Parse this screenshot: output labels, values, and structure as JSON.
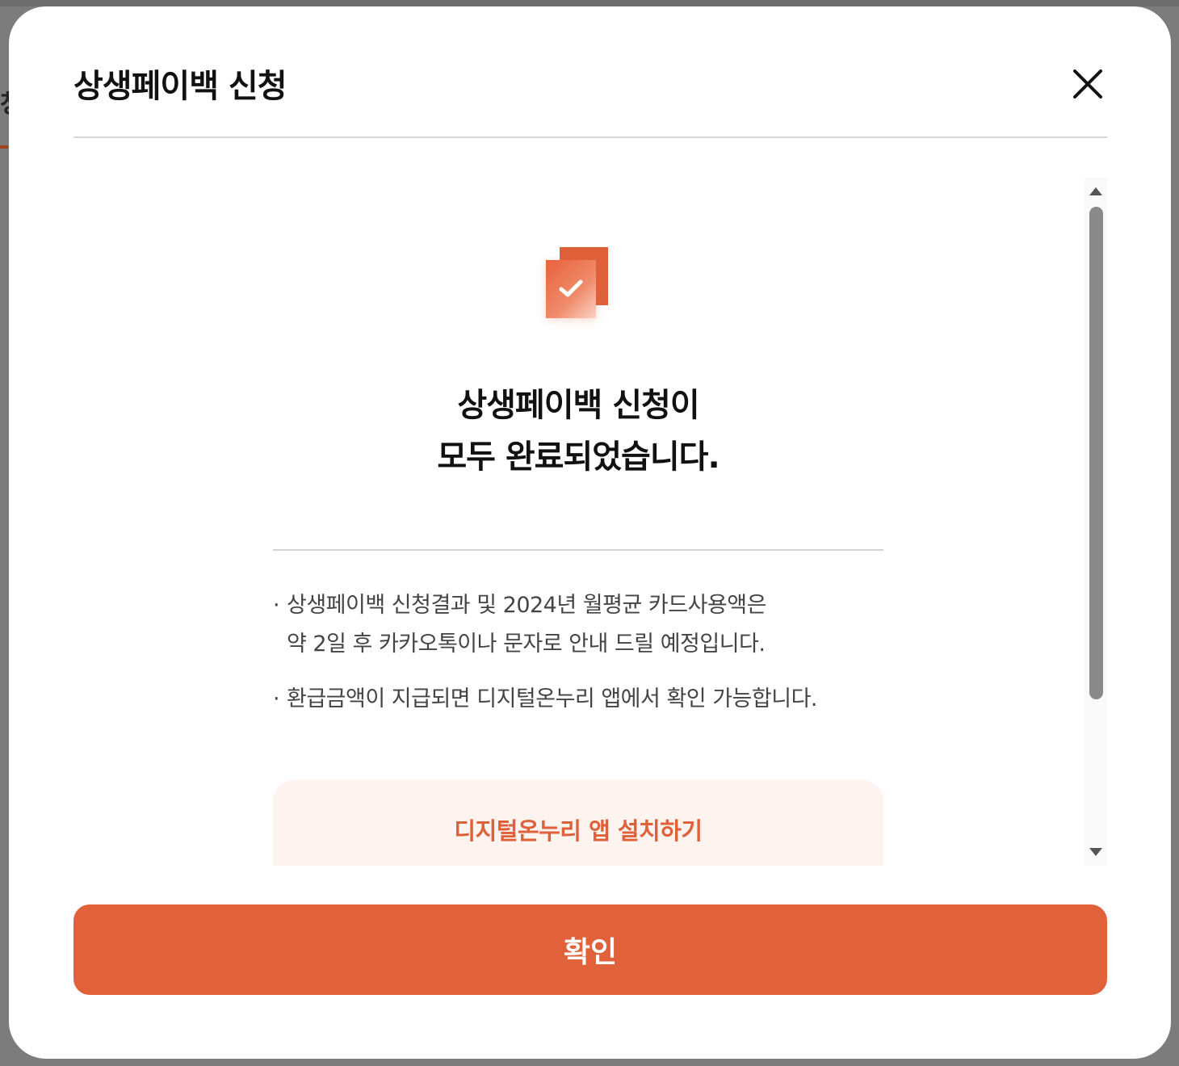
{
  "background": {
    "fragment_text": "청"
  },
  "modal": {
    "title": "상생페이백 신청",
    "close_icon": "close-icon"
  },
  "success": {
    "icon": "check-document-icon",
    "title_line1": "상생페이백 신청이",
    "title_line2": "모두 완료되었습니다."
  },
  "notices": [
    {
      "bullet": "·",
      "lines": [
        "상생페이백 신청결과 및 2024년 월평균 카드사용액은",
        "약 2일 후 카카오톡이나 문자로 안내 드릴 예정입니다."
      ]
    },
    {
      "bullet": "·",
      "lines": [
        "환급금액이 지급되면 디지털온누리 앱에서 확인 가능합니다."
      ]
    }
  ],
  "install": {
    "label": "디지털온누리 앱 설치하기"
  },
  "footer": {
    "confirm_label": "확인"
  },
  "colors": {
    "accent": "#e0613a",
    "install_bg": "#fdf3ef",
    "scroll_thumb": "#8a8a8a"
  }
}
